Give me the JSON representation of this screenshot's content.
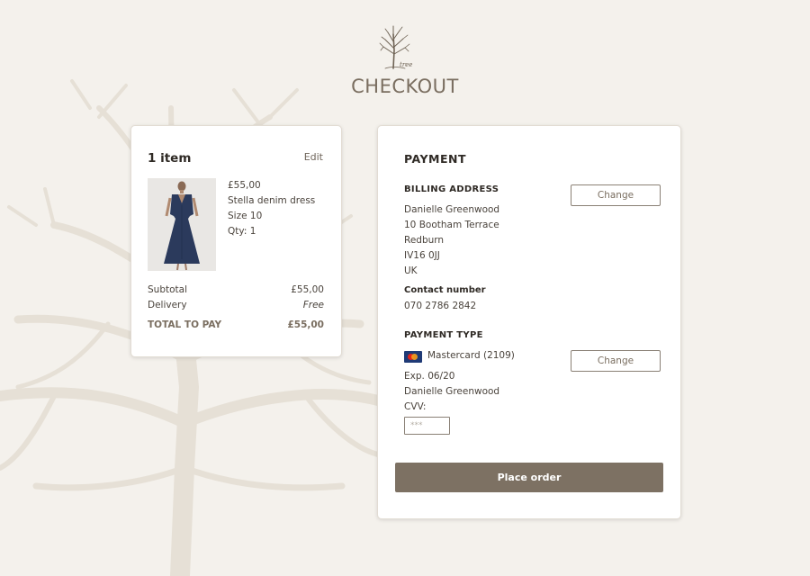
{
  "brand": {
    "logo_text": "tree",
    "logo_icon": "tree-icon"
  },
  "page": {
    "title": "CHECKOUT"
  },
  "cart": {
    "count_label": "1 item",
    "edit_label": "Edit",
    "product": {
      "price": "£55,00",
      "name": "Stella denim dress",
      "size": "Size 10",
      "qty": "Qty: 1",
      "image_icon": "dress-image",
      "dress_color": "#2b3a5c"
    },
    "summary": {
      "subtotal_label": "Subtotal",
      "subtotal_value": "£55,00",
      "delivery_label": "Delivery",
      "delivery_value": "Free",
      "total_label": "TOTAL TO PAY",
      "total_value": "£55,00"
    }
  },
  "payment": {
    "title": "PAYMENT",
    "billing": {
      "title": "BILLING ADDRESS",
      "change_label": "Change",
      "lines": [
        "Danielle Greenwood",
        "10 Bootham Terrace",
        "Redburn",
        "IV16 0JJ",
        "UK"
      ],
      "contact_label": "Contact number",
      "contact_value": "070 2786 2842"
    },
    "method": {
      "title": "PAYMENT TYPE",
      "change_label": "Change",
      "card_icon": "mastercard-icon",
      "card_label": "Mastercard (2109)",
      "expiry": "Exp. 06/20",
      "holder": "Danielle Greenwood",
      "cvv_label": "CVV:",
      "cvv_placeholder": "***"
    },
    "place_order_label": "Place order"
  },
  "colors": {
    "background": "#f4f1ec",
    "accent": "#7d7163",
    "text": "#3a3530"
  }
}
